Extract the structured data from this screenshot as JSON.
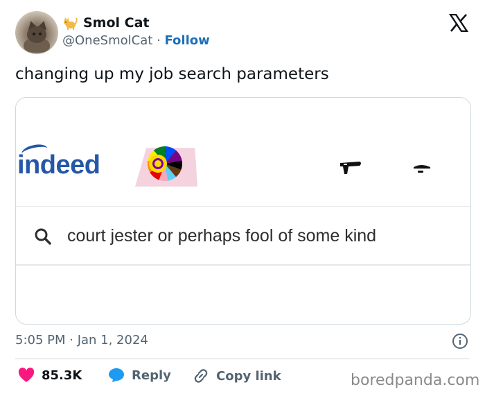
{
  "author": {
    "display_name": "Smol Cat",
    "handle": "@OneSmolCat",
    "separator": "·",
    "follow_label": "Follow",
    "name_emoji": "cat-emoji"
  },
  "tweet": {
    "text": "changing up my job search parameters"
  },
  "media": {
    "logo_text": "indeed",
    "search_query": "court jester or perhaps fool of some kind",
    "icons": [
      "pride-badge",
      "megaphone-icon",
      "message-icon",
      "search-icon"
    ]
  },
  "meta": {
    "timestamp": "5:05 PM · Jan 1, 2024"
  },
  "actions": {
    "likes_count": "85.3K",
    "reply_label": "Reply",
    "copy_link_label": "Copy link"
  },
  "watermark": "boredpanda.com",
  "colors": {
    "brand_blue": "#1d6fb8",
    "indeed_blue": "#2557a7",
    "like_pink": "#f91880",
    "reply_blue": "#1d9bf0",
    "muted_text": "#536471"
  }
}
